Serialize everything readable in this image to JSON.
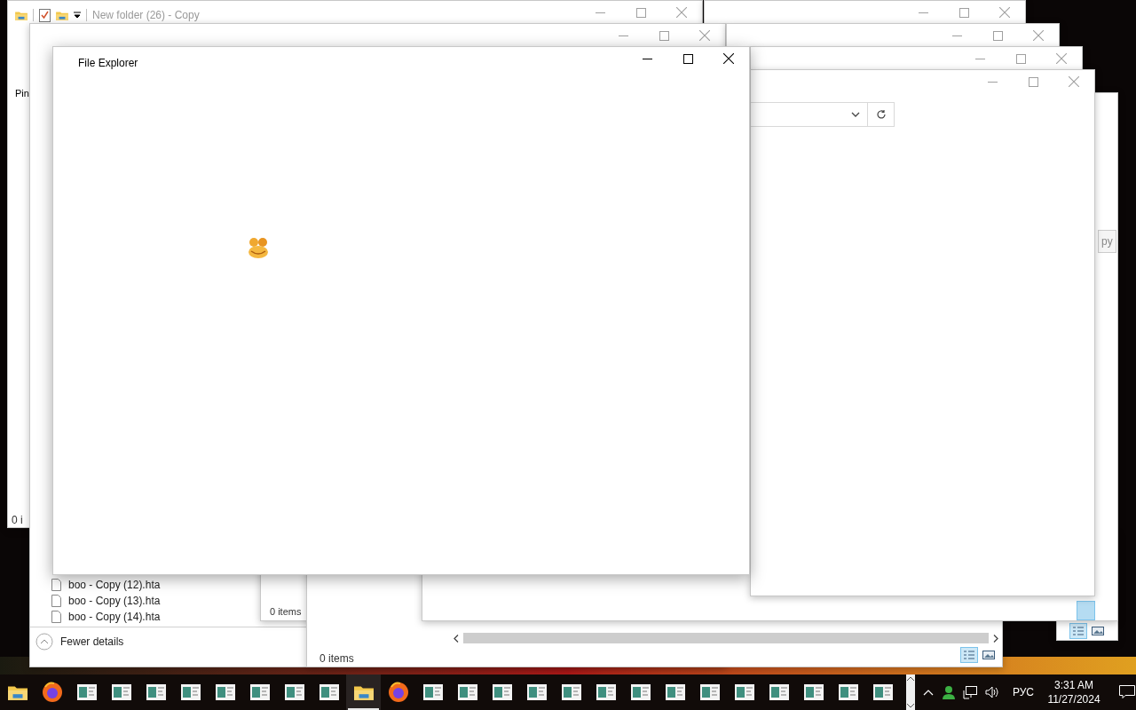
{
  "windows": [
    {
      "kind": "explorer",
      "title": "New folder (26) - Copy",
      "sidebar_text": "Pin",
      "status": "0 i"
    },
    {
      "kind": "files",
      "items": [
        "boo - Copy (12).hta",
        "boo - Copy (13).hta",
        "boo - Copy (14).hta"
      ],
      "toggle": "Fewer details"
    },
    {
      "kind": "status",
      "status": "0 items"
    },
    {
      "kind": "status_scroll",
      "status": "0 items"
    },
    {
      "kind": "partial",
      "button": "py"
    },
    {
      "kind": "front",
      "title": "File Explorer"
    }
  ],
  "taskbar": {
    "items": [
      {
        "kind": "folder",
        "selected": false
      },
      {
        "kind": "firefox",
        "selected": false
      },
      {
        "kind": "app",
        "selected": false
      },
      {
        "kind": "app",
        "selected": false
      },
      {
        "kind": "app",
        "selected": false
      },
      {
        "kind": "app",
        "selected": false
      },
      {
        "kind": "app",
        "selected": false
      },
      {
        "kind": "app",
        "selected": false
      },
      {
        "kind": "app",
        "selected": false
      },
      {
        "kind": "app",
        "selected": false
      },
      {
        "kind": "folder",
        "selected": true
      },
      {
        "kind": "firefox",
        "selected": false
      },
      {
        "kind": "app",
        "selected": false
      },
      {
        "kind": "app",
        "selected": false
      },
      {
        "kind": "app",
        "selected": false
      },
      {
        "kind": "app",
        "selected": false
      },
      {
        "kind": "app",
        "selected": false
      },
      {
        "kind": "app",
        "selected": false
      },
      {
        "kind": "app",
        "selected": false
      },
      {
        "kind": "app",
        "selected": false
      },
      {
        "kind": "app",
        "selected": false
      },
      {
        "kind": "app",
        "selected": false
      },
      {
        "kind": "app",
        "selected": false
      },
      {
        "kind": "app",
        "selected": false
      },
      {
        "kind": "app",
        "selected": false
      },
      {
        "kind": "app",
        "selected": false
      }
    ],
    "language": "РУС",
    "time": "3:31 AM",
    "date": "11/27/2024"
  }
}
